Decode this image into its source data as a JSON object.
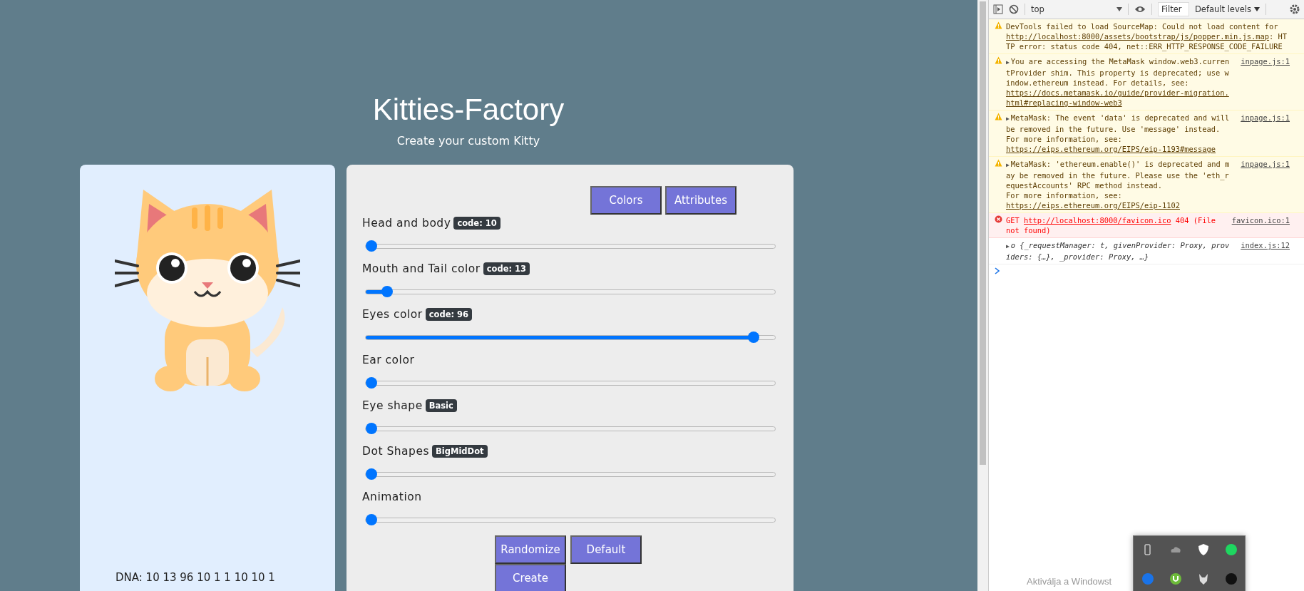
{
  "page": {
    "title": "Kitties-Factory",
    "subtitle": "Create your custom Kitty"
  },
  "cat_card": {
    "dna": "DNA: 10 13 96 10 1 1 10 10 1"
  },
  "controls": {
    "tabs": [
      {
        "label": "Colors"
      },
      {
        "label": "Attributes"
      }
    ],
    "sliders": [
      {
        "label": "Head and body",
        "badge": "code: 10",
        "level": 0
      },
      {
        "label": "Mouth and Tail color",
        "badge": "code: 13",
        "level": 0.04
      },
      {
        "label": "Eyes color",
        "badge": "code: 96",
        "level": 0.96
      },
      {
        "label": "Ear color",
        "level": 0
      },
      {
        "label": "Eye shape",
        "badge": "Basic",
        "level": 0
      },
      {
        "label": "Dot Shapes",
        "badge": "BigMidDot",
        "level": 0
      },
      {
        "label": "Animation",
        "level": 0
      }
    ],
    "buttons": [
      {
        "label": "Randomize"
      },
      {
        "label": "Default"
      },
      {
        "label": "Create"
      }
    ]
  },
  "devtools": {
    "context": "top",
    "filter_placeholder": "Filter",
    "levels": "Default levels",
    "messages": [
      {
        "kind": "warning",
        "segments": [
          {
            "text": "DevTools failed to load SourceMap: Could not load content for "
          },
          {
            "text": "http://localhost:8000/assets/bootstrap/js/popper.min.js.map",
            "kind": "url"
          },
          {
            "text": ": HTTP error: status code 404, net::ERR_HTTP_RESPONSE_CODE_FAILURE"
          }
        ]
      },
      {
        "kind": "warning",
        "toggle": "▶",
        "source": "inpage.js:1",
        "segments": [
          {
            "text": "You are accessing the MetaMask window.web3.currentProvider shim. This property is deprecated; use window.ethereum instead. For details, see: "
          },
          {
            "text": "https://docs.metamask.io/guide/provider-migration.html#replacing-window-web3",
            "kind": "url"
          }
        ]
      },
      {
        "kind": "warning",
        "toggle": "▶",
        "source": "inpage.js:1",
        "segments": [
          {
            "text": "MetaMask: The event 'data' is deprecated and will be removed in the future. Use 'message' instead.\nFor more information, see: "
          },
          {
            "text": "https://eips.ethereum.org/EIPS/eip-1193#message",
            "kind": "url"
          }
        ]
      },
      {
        "kind": "warning",
        "toggle": "▶",
        "source": "inpage.js:1",
        "segments": [
          {
            "text": "MetaMask: 'ethereum.enable()' is deprecated and may be removed in the future. Please use the 'eth_requestAccounts' RPC method instead.\nFor more information, see: "
          },
          {
            "text": "https://eips.ethereum.org/EIPS/eip-1102",
            "kind": "url"
          }
        ]
      },
      {
        "kind": "error",
        "source": "favicon.ico:1",
        "segments": [
          {
            "text": "GET "
          },
          {
            "text": "http://localhost:8000/favicon.ico",
            "kind": "url"
          },
          {
            "text": " 404 (File not found)"
          }
        ]
      },
      {
        "kind": "log",
        "toggle": "▶",
        "source": "index.js:12",
        "segments": [
          {
            "text": "o {_requestManager: t, givenProvider: Proxy, providers: {…}, _provider: Proxy, …}"
          }
        ]
      }
    ]
  },
  "os_overlay": {
    "activation_text": "Aktiválja a Windowst"
  }
}
